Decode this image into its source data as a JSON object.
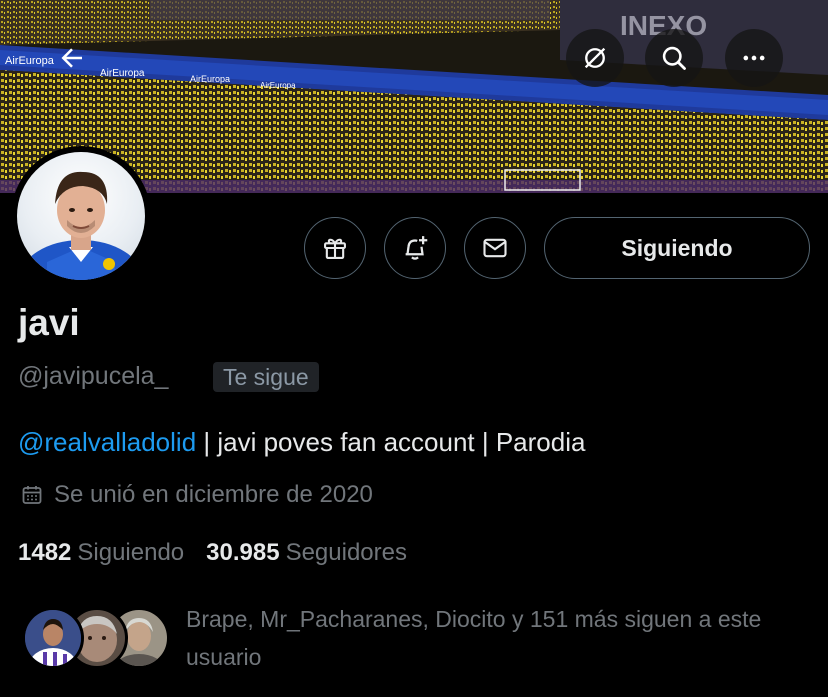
{
  "header": {
    "icons": [
      "back-arrow-icon",
      "block-icon",
      "search-icon",
      "more-icon"
    ],
    "banner_text": [
      "AirEuropa",
      "INEXO"
    ]
  },
  "profile": {
    "name": "javi",
    "handle": "@javipucela_",
    "follows_you_badge": "Te sigue",
    "bio_mention": "@realvalladolid",
    "bio_rest": " | javi poves fan account | Parodia",
    "joined": "Se unió en diciembre de 2020",
    "following_count": "1482",
    "following_label": "Siguiendo",
    "followers_count": "30.985",
    "followers_label": "Seguidores",
    "known_followers": "Brape, Mr_Pacharanes, Diocito y 151 más siguen a este usuario"
  },
  "actions": {
    "follow_label": "Siguiendo",
    "icons": [
      "gift-icon",
      "notification-add-icon",
      "mail-icon"
    ]
  },
  "colors": {
    "background": "#000000",
    "text": "#e7e9ea",
    "muted": "#71767b",
    "link": "#1d9bf0",
    "border": "#536471"
  }
}
